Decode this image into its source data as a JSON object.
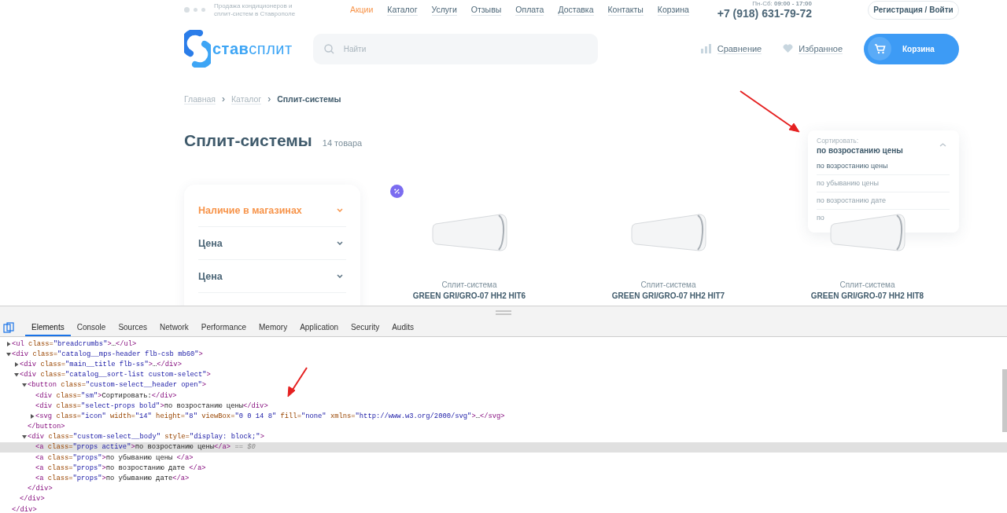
{
  "header": {
    "tagline": [
      "Продажа кондиционеров и",
      "сплит-систем в Ставрополе"
    ],
    "nav": [
      {
        "label": "Акции",
        "selected": true
      },
      {
        "label": "Каталог",
        "selected": false
      },
      {
        "label": "Услуги",
        "selected": false
      },
      {
        "label": "Отзывы",
        "selected": false
      },
      {
        "label": "Оплата",
        "selected": false
      },
      {
        "label": "Доставка",
        "selected": false
      },
      {
        "label": "Контакты",
        "selected": false
      },
      {
        "label": "Корзина",
        "selected": false
      }
    ],
    "hours": "Пн-Сб: **09:00 - 17:00**",
    "phone": "+7 (918) 631-79-72",
    "login_button": "Регистрация / Войти",
    "logo": "**став**сплит",
    "search": {
      "placeholder": "Найти"
    },
    "compare": "Сравнение",
    "favorites": "Избранное",
    "cart_button": "Корзина"
  },
  "breadcrumb_separator": "›",
  "breadcrumbs": [
    {
      "label": "Главная",
      "current": false
    },
    {
      "label": "Каталог",
      "current": false
    },
    {
      "label": "Сплит-системы",
      "current": true
    }
  ],
  "title": "Сплит-системы",
  "count": "14 товара",
  "filters": [
    {
      "label": "Наличие в магазинах",
      "active": true
    },
    {
      "label": "Цена",
      "active": false
    },
    {
      "label": "Цена",
      "active": false
    }
  ],
  "products": [
    {
      "category": "Сплит-система",
      "name": "GREEN GRI/GRO-07 HH2 HIT6"
    },
    {
      "category": "Сплит-система",
      "name": "GREEN GRI/GRO-07 HH2 HIT7"
    },
    {
      "category": "Сплит-система",
      "name": "GREEN GRI/GRO-07 HH2 HIT8"
    }
  ],
  "sort": {
    "label": "Сортировать:",
    "value": "по возростанию цены",
    "options": [
      {
        "label": "по возростанию цены",
        "selected": true
      },
      {
        "label": "по убыванию цены",
        "selected": false
      },
      {
        "label": "по возростанию дате",
        "selected": false
      },
      {
        "label": "по",
        "selected": false
      }
    ]
  },
  "devtools": {
    "tabs": [
      {
        "label": "Elements",
        "selected": true
      },
      {
        "label": "Console",
        "selected": false
      },
      {
        "label": "Sources",
        "selected": false
      },
      {
        "label": "Network",
        "selected": false
      },
      {
        "label": "Performance",
        "selected": false
      },
      {
        "label": "Memory",
        "selected": false
      },
      {
        "label": "Application",
        "selected": false
      },
      {
        "label": "Security",
        "selected": false
      },
      {
        "label": "Audits",
        "selected": false
      }
    ],
    "dom_tree": [
      {
        "kind": "element",
        "expanded": false,
        "selected": false,
        "tokens": [
          {
            "kind": "tag",
            "text": "<ul"
          },
          {
            "kind": "attr",
            "text": " class="
          },
          {
            "kind": "value",
            "text": "\"breadcrumbs\""
          },
          {
            "kind": "tag",
            "text": ">"
          },
          {
            "kind": "text",
            "text": "…"
          },
          {
            "kind": "tag",
            "text": "</ul>"
          }
        ]
      },
      {
        "kind": "element",
        "expanded": true,
        "selected": false,
        "tokens": [
          {
            "kind": "tag",
            "text": "<div"
          },
          {
            "kind": "attr",
            "text": " class="
          },
          {
            "kind": "value",
            "text": "\"catalog__mps-header flb-csb mb60\""
          },
          {
            "kind": "tag",
            "text": ">"
          }
        ],
        "closing": [
          {
            "kind": "tag",
            "text": "</div>"
          }
        ],
        "children": [
          {
            "kind": "element",
            "expanded": false,
            "selected": false,
            "tokens": [
              {
                "kind": "tag",
                "text": "<div"
              },
              {
                "kind": "attr",
                "text": " class="
              },
              {
                "kind": "value",
                "text": "\"main__title flb-ss\""
              },
              {
                "kind": "tag",
                "text": ">"
              },
              {
                "kind": "text",
                "text": "…"
              },
              {
                "kind": "tag",
                "text": "</div>"
              }
            ]
          },
          {
            "kind": "element",
            "expanded": true,
            "selected": false,
            "tokens": [
              {
                "kind": "tag",
                "text": "<div"
              },
              {
                "kind": "attr",
                "text": " class="
              },
              {
                "kind": "value",
                "text": "\"catalog__sort-list custom-select\""
              },
              {
                "kind": "tag",
                "text": ">"
              }
            ],
            "closing": [
              {
                "kind": "tag",
                "text": "</div>"
              }
            ],
            "children": [
              {
                "kind": "element",
                "expanded": true,
                "selected": false,
                "tokens": [
                  {
                    "kind": "tag",
                    "text": "<button"
                  },
                  {
                    "kind": "attr",
                    "text": " class="
                  },
                  {
                    "kind": "value",
                    "text": "\"custom-select__header open\""
                  },
                  {
                    "kind": "tag",
                    "text": ">"
                  }
                ],
                "closing": [
                  {
                    "kind": "tag",
                    "text": "</button>"
                  }
                ],
                "children": [
                  {
                    "kind": "line",
                    "selected": false,
                    "tokens": [
                      {
                        "kind": "tag",
                        "text": "<div"
                      },
                      {
                        "kind": "attr",
                        "text": " class="
                      },
                      {
                        "kind": "value",
                        "text": "\"sm\""
                      },
                      {
                        "kind": "tag",
                        "text": ">"
                      },
                      {
                        "kind": "text",
                        "text": "Сортировать:"
                      },
                      {
                        "kind": "tag",
                        "text": "</div>"
                      }
                    ]
                  },
                  {
                    "kind": "line",
                    "selected": false,
                    "tokens": [
                      {
                        "kind": "tag",
                        "text": "<div"
                      },
                      {
                        "kind": "attr",
                        "text": " class="
                      },
                      {
                        "kind": "value",
                        "text": "\"select-props bold\""
                      },
                      {
                        "kind": "tag",
                        "text": ">"
                      },
                      {
                        "kind": "text",
                        "text": "по возростанию цены"
                      },
                      {
                        "kind": "tag",
                        "text": "</div>"
                      }
                    ]
                  },
                  {
                    "kind": "element",
                    "expanded": false,
                    "selected": false,
                    "tokens": [
                      {
                        "kind": "tag",
                        "text": "<svg"
                      },
                      {
                        "kind": "attr",
                        "text": " class="
                      },
                      {
                        "kind": "value",
                        "text": "\"icon\""
                      },
                      {
                        "kind": "attr",
                        "text": " width="
                      },
                      {
                        "kind": "value",
                        "text": "\"14\""
                      },
                      {
                        "kind": "attr",
                        "text": " height="
                      },
                      {
                        "kind": "value",
                        "text": "\"8\""
                      },
                      {
                        "kind": "attr",
                        "text": " viewBox="
                      },
                      {
                        "kind": "value",
                        "text": "\"0 0 14 8\""
                      },
                      {
                        "kind": "attr",
                        "text": " fill="
                      },
                      {
                        "kind": "value",
                        "text": "\"none\""
                      },
                      {
                        "kind": "attr",
                        "text": " xmlns="
                      },
                      {
                        "kind": "value",
                        "text": "\"http://www.w3.org/2000/svg\""
                      },
                      {
                        "kind": "tag",
                        "text": ">"
                      },
                      {
                        "kind": "text",
                        "text": "…"
                      },
                      {
                        "kind": "tag",
                        "text": "</svg>"
                      }
                    ]
                  }
                ]
              },
              {
                "kind": "element",
                "expanded": true,
                "selected": false,
                "tokens": [
                  {
                    "kind": "tag",
                    "text": "<div"
                  },
                  {
                    "kind": "attr",
                    "text": " class="
                  },
                  {
                    "kind": "value",
                    "text": "\"custom-select__body\""
                  },
                  {
                    "kind": "attr",
                    "text": " style="
                  },
                  {
                    "kind": "value",
                    "text": "\"display: block;\""
                  },
                  {
                    "kind": "tag",
                    "text": ">"
                  }
                ],
                "closing": [
                  {
                    "kind": "tag",
                    "text": "</div>"
                  }
                ],
                "children": [
                  {
                    "kind": "line",
                    "selected": true,
                    "tokens": [
                      {
                        "kind": "tag",
                        "text": "<a"
                      },
                      {
                        "kind": "attr",
                        "text": " class="
                      },
                      {
                        "kind": "value",
                        "text": "\"props active\""
                      },
                      {
                        "kind": "tag",
                        "text": ">"
                      },
                      {
                        "kind": "text",
                        "text": "по возростанию цены"
                      },
                      {
                        "kind": "tag",
                        "text": "</a>"
                      },
                      {
                        "kind": "marker",
                        "text": " == $0"
                      }
                    ]
                  },
                  {
                    "kind": "line",
                    "selected": false,
                    "tokens": [
                      {
                        "kind": "tag",
                        "text": "<a"
                      },
                      {
                        "kind": "attr",
                        "text": " class="
                      },
                      {
                        "kind": "value",
                        "text": "\"props\""
                      },
                      {
                        "kind": "tag",
                        "text": ">"
                      },
                      {
                        "kind": "text",
                        "text": "по убыванию цены "
                      },
                      {
                        "kind": "tag",
                        "text": "</a>"
                      }
                    ]
                  },
                  {
                    "kind": "line",
                    "selected": false,
                    "tokens": [
                      {
                        "kind": "tag",
                        "text": "<a"
                      },
                      {
                        "kind": "attr",
                        "text": " class="
                      },
                      {
                        "kind": "value",
                        "text": "\"props\""
                      },
                      {
                        "kind": "tag",
                        "text": ">"
                      },
                      {
                        "kind": "text",
                        "text": "по возростанию дате "
                      },
                      {
                        "kind": "tag",
                        "text": "</a>"
                      }
                    ]
                  },
                  {
                    "kind": "line",
                    "selected": false,
                    "tokens": [
                      {
                        "kind": "tag",
                        "text": "<a"
                      },
                      {
                        "kind": "attr",
                        "text": " class="
                      },
                      {
                        "kind": "value",
                        "text": "\"props\""
                      },
                      {
                        "kind": "tag",
                        "text": ">"
                      },
                      {
                        "kind": "text",
                        "text": "по убыванию дате"
                      },
                      {
                        "kind": "tag",
                        "text": "</a>"
                      }
                    ]
                  }
                ]
              }
            ]
          }
        ]
      }
    ]
  }
}
